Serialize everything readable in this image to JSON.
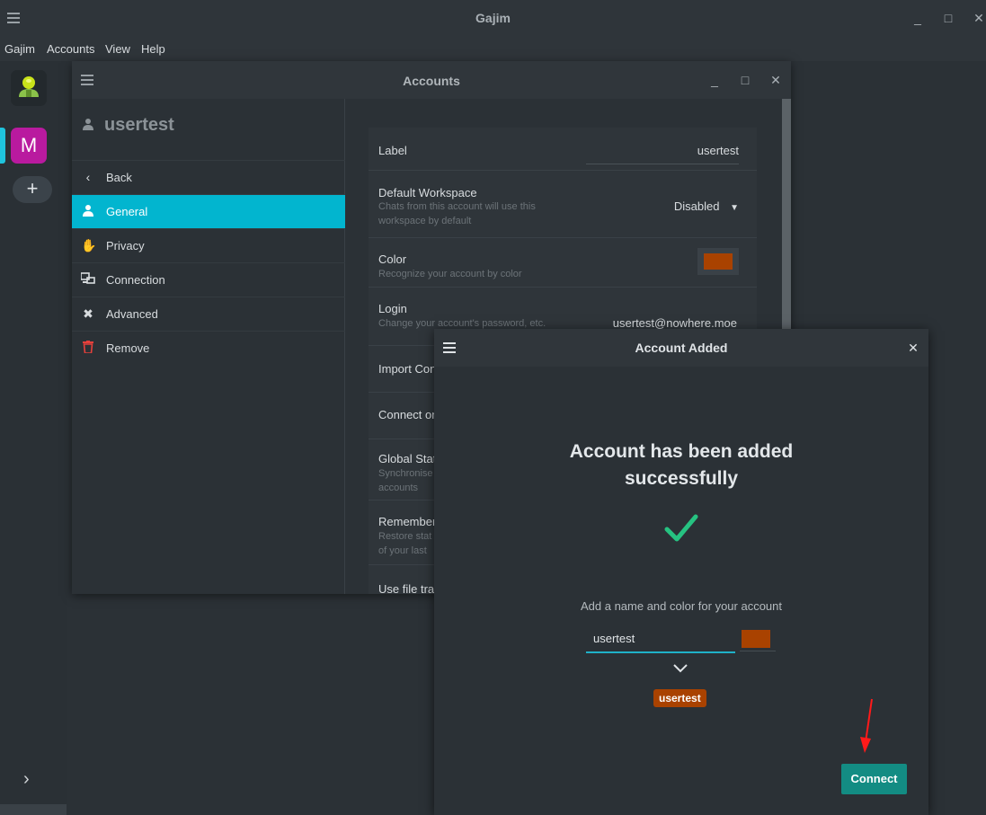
{
  "app": {
    "title": "Gajim"
  },
  "menu": {
    "items": [
      "Gajim",
      "Accounts",
      "View",
      "Help"
    ]
  },
  "leftbar": {
    "account_initial": "M",
    "add_label": "+",
    "expand_label": "›"
  },
  "accounts_window": {
    "title": "Accounts",
    "sidebar": {
      "username": "usertest",
      "items": [
        {
          "label": "Back",
          "icon": "chevron-left-icon"
        },
        {
          "label": "General",
          "icon": "person-icon"
        },
        {
          "label": "Privacy",
          "icon": "hand-icon"
        },
        {
          "label": "Connection",
          "icon": "network-icon"
        },
        {
          "label": "Advanced",
          "icon": "tools-icon"
        },
        {
          "label": "Remove",
          "icon": "trash-icon"
        }
      ]
    },
    "settings": {
      "label": {
        "title": "Label",
        "value": "usertest"
      },
      "workspace": {
        "title": "Default Workspace",
        "desc": "Chats from this account will use this workspace by default",
        "value": "Disabled"
      },
      "color": {
        "title": "Color",
        "desc": "Recognize your account by color",
        "value": "#a94200"
      },
      "login": {
        "title": "Login",
        "desc": "Change your account's password, etc.",
        "value": "usertest@nowhere.moe"
      },
      "import": {
        "title": "Import Con"
      },
      "connect": {
        "title": "Connect on"
      },
      "global": {
        "title": "Global Stat",
        "desc": "Synchronise accounts"
      },
      "remember": {
        "title": "Remember",
        "desc": "Restore stat of your last"
      },
      "filetransfer": {
        "title": "Use file tra"
      }
    }
  },
  "dialog": {
    "title": "Account Added",
    "headline_line1": "Account has been added",
    "headline_line2": "successfully",
    "subtitle": "Add a name and color for your account",
    "name_value": "usertest",
    "badge": "usertest",
    "connect_label": "Connect",
    "accent": "#a94200",
    "success_color": "#26c281"
  }
}
